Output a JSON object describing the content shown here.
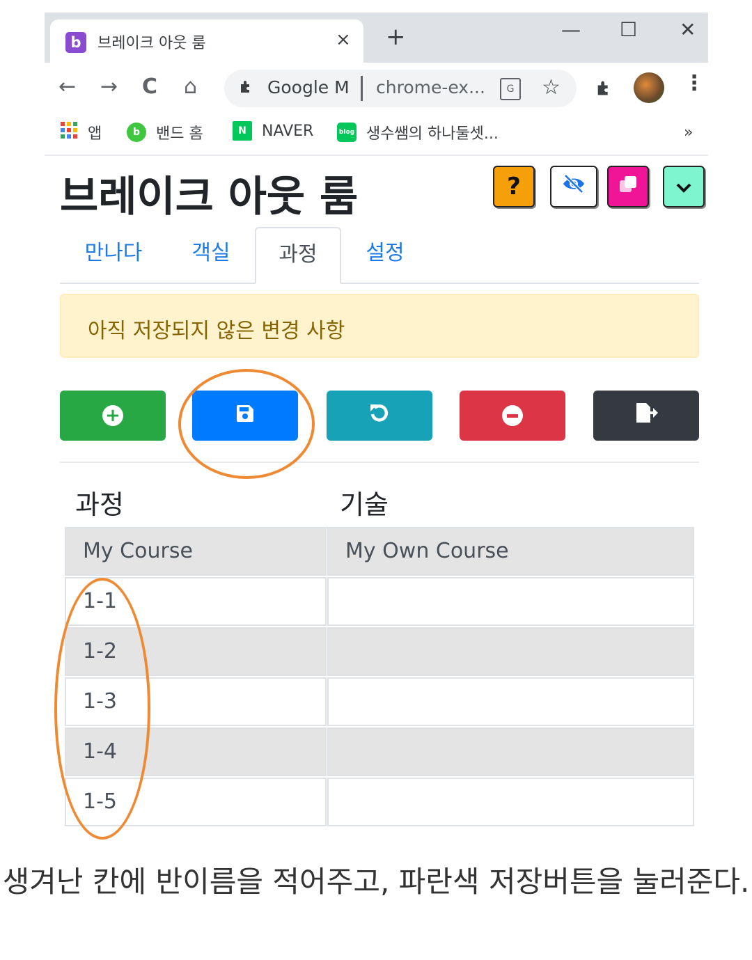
{
  "browser": {
    "tab_title": "브레이크 아웃 룸",
    "tab_favicon": "b",
    "tab_close": "×",
    "new_tab": "+",
    "window_controls": {
      "minimize": "—",
      "maximize": "☐",
      "close": "✕"
    },
    "nav": {
      "back": "←",
      "forward": "→",
      "reload": "C",
      "home": "⌂"
    },
    "omnibox": {
      "ext_name": "Google M",
      "url": "chrome-ex...",
      "translate_icon": "G",
      "star": "☆"
    },
    "ext_icon": "puzzle-icon",
    "menu": "⋮",
    "bookmarks": [
      {
        "label": "앱",
        "icon": "apps-grid-icon"
      },
      {
        "label": "밴드 홈",
        "icon": "band-icon"
      },
      {
        "label": "NAVER",
        "icon": "naver-icon"
      },
      {
        "label": "생수쌤의 하나둘셋...",
        "icon": "blog-icon"
      }
    ],
    "bookmarks_more": "»"
  },
  "app": {
    "title": "브레이크 아웃 룸",
    "header_buttons": {
      "help": "?",
      "hide_icon": "eye-slash-icon",
      "copy_icon": "copy-icon",
      "expand_icon": "chevron-down-icon"
    },
    "tabs": [
      {
        "label": "만나다",
        "active": false
      },
      {
        "label": "객실",
        "active": false
      },
      {
        "label": "과정",
        "active": true
      },
      {
        "label": "설정",
        "active": false
      }
    ],
    "alert": "아직 저장되지 않은 변경 사항",
    "action_buttons": [
      {
        "name": "add",
        "icon": "plus-circle-icon",
        "color": "#28a745"
      },
      {
        "name": "save",
        "icon": "floppy-disk-icon",
        "color": "#007bff"
      },
      {
        "name": "revert",
        "icon": "undo-icon",
        "color": "#17a2b8"
      },
      {
        "name": "delete",
        "icon": "minus-circle-icon",
        "color": "#dc3545"
      },
      {
        "name": "export",
        "icon": "file-export-icon",
        "color": "#343a40"
      }
    ],
    "table": {
      "headers": [
        "과정",
        "기술"
      ],
      "rows": [
        {
          "course": "My Course",
          "skill": "My Own Course"
        },
        {
          "course": "1-1",
          "skill": ""
        },
        {
          "course": "1-2",
          "skill": ""
        },
        {
          "course": "1-3",
          "skill": ""
        },
        {
          "course": "1-4",
          "skill": ""
        },
        {
          "course": "1-5",
          "skill": ""
        }
      ]
    }
  },
  "annotation_color": "#ef8a34",
  "caption": "생겨난 칸에 반이름을 적어주고, 파란색 저장버튼을 눌러준다."
}
